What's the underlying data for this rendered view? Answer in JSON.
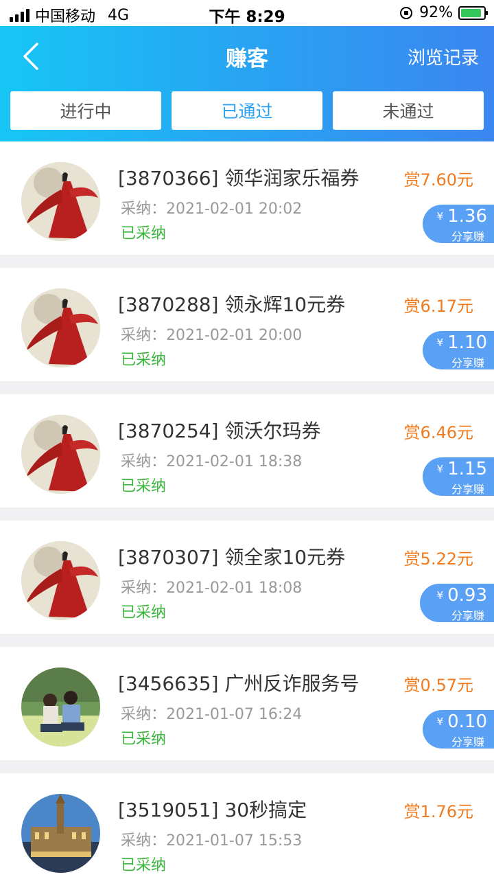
{
  "status_bar": {
    "carrier": "中国移动",
    "network": "4G",
    "time": "下午 8:29",
    "battery": "92%"
  },
  "nav": {
    "title": "赚客",
    "right_label": "浏览记录"
  },
  "tabs": [
    {
      "label": "进行中",
      "active": false
    },
    {
      "label": "已通过",
      "active": true
    },
    {
      "label": "未通过",
      "active": false
    }
  ],
  "items": [
    {
      "title": "[3870366] 领华润家乐福券",
      "time": "采纳：2021-02-01 20:02",
      "status": "已采纳",
      "reward": "赏7.60元",
      "currency": "¥",
      "share_amount": "1.36",
      "share_label": "分享赚",
      "avatar": "red-dress-figure"
    },
    {
      "title": "[3870288] 领永辉10元券",
      "time": "采纳：2021-02-01 20:00",
      "status": "已采纳",
      "reward": "赏6.17元",
      "currency": "¥",
      "share_amount": "1.10",
      "share_label": "分享赚",
      "avatar": "red-dress-figure"
    },
    {
      "title": "[3870254] 领沃尔玛券",
      "time": "采纳：2021-02-01 18:38",
      "status": "已采纳",
      "reward": "赏6.46元",
      "currency": "¥",
      "share_amount": "1.15",
      "share_label": "分享赚",
      "avatar": "red-dress-figure"
    },
    {
      "title": "[3870307] 领全家10元券",
      "time": "采纳：2021-02-01 18:08",
      "status": "已采纳",
      "reward": "赏5.22元",
      "currency": "¥",
      "share_amount": "0.93",
      "share_label": "分享赚",
      "avatar": "red-dress-figure"
    },
    {
      "title": "[3456635] 广州反诈服务号",
      "time": "采纳：2021-01-07 16:24",
      "status": "已采纳",
      "reward": "赏0.57元",
      "currency": "¥",
      "share_amount": "0.10",
      "share_label": "分享赚",
      "avatar": "couple-on-grass"
    },
    {
      "title": "[3519051] 30秒搞定",
      "time": "采纳：2021-01-07 15:53",
      "status": "已采纳",
      "reward": "赏1.76元",
      "avatar": "town-hall"
    }
  ],
  "colors": {
    "header_gradient_start": "#17c6f5",
    "header_gradient_end": "#3b86f0",
    "reward": "#f07a1e",
    "status_green": "#3bb53b",
    "share_badge": "#5aa0f5",
    "active_tab": "#2aa0f2"
  }
}
